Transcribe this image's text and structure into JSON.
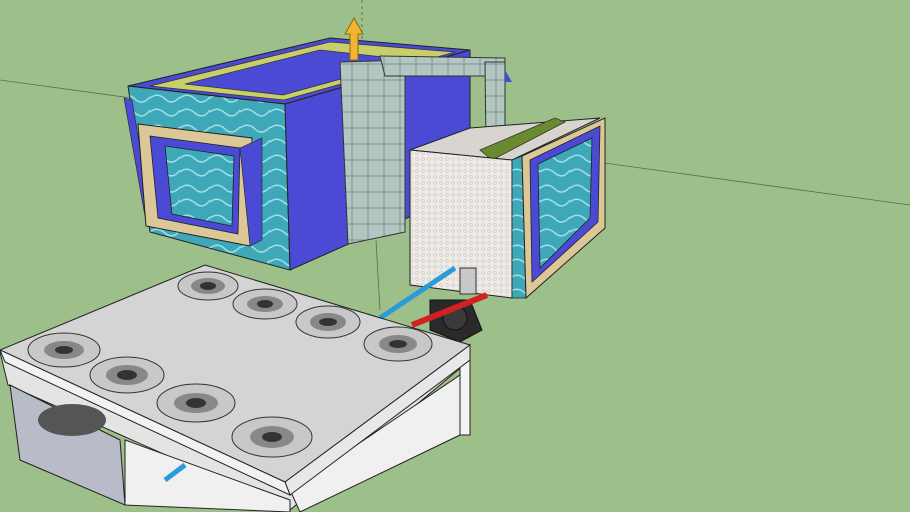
{
  "viewport": {
    "background_color": "#9dbf8a",
    "axis_color": "#4a5a44"
  },
  "model": {
    "pool_water_color": "#3fa8b8",
    "pool_wall_color": "#4a4ad4",
    "pool_top_color": "#c8cf6a",
    "frame_color": "#dcc896",
    "glass_color": "#b4c6c2",
    "tank_face_color": "#eeeae6",
    "unit_top_color": "#d4d4d4",
    "fan_disc_color": "#c8c8c8",
    "cold_pipe_color": "#2a9ad8",
    "hot_pipe_color": "#d42020",
    "arrow_color": "#f2b430"
  }
}
